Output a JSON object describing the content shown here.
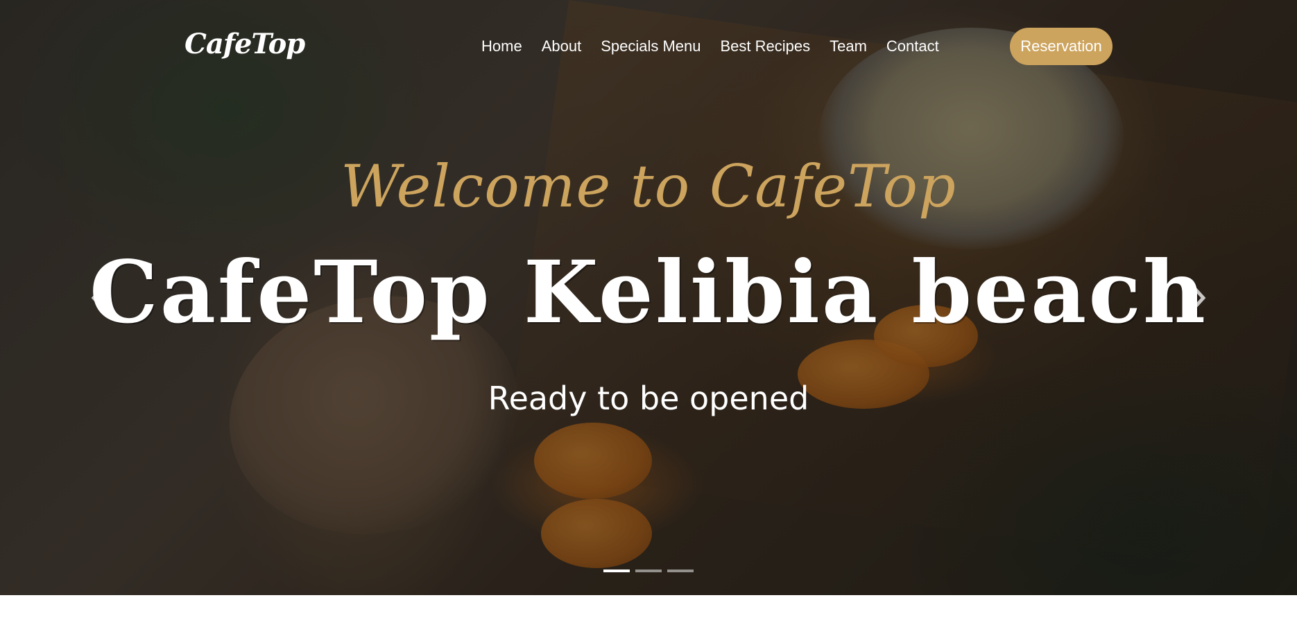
{
  "header": {
    "logo": "CafeTop",
    "nav": [
      {
        "label": "Home"
      },
      {
        "label": "About"
      },
      {
        "label": "Specials Menu"
      },
      {
        "label": "Best Recipes"
      },
      {
        "label": "Team"
      },
      {
        "label": "Contact"
      }
    ],
    "reservation_label": "Reservation"
  },
  "hero": {
    "welcome": "Welcome to CafeTop",
    "headline": "CafeTop Kelibia beach",
    "subtitle": "Ready to be opened",
    "slides_total": 3,
    "active_slide": 1,
    "prev_icon": "chevron-left-icon",
    "next_icon": "chevron-right-icon"
  },
  "colors": {
    "accent": "#cda45e",
    "text": "#ffffff"
  }
}
